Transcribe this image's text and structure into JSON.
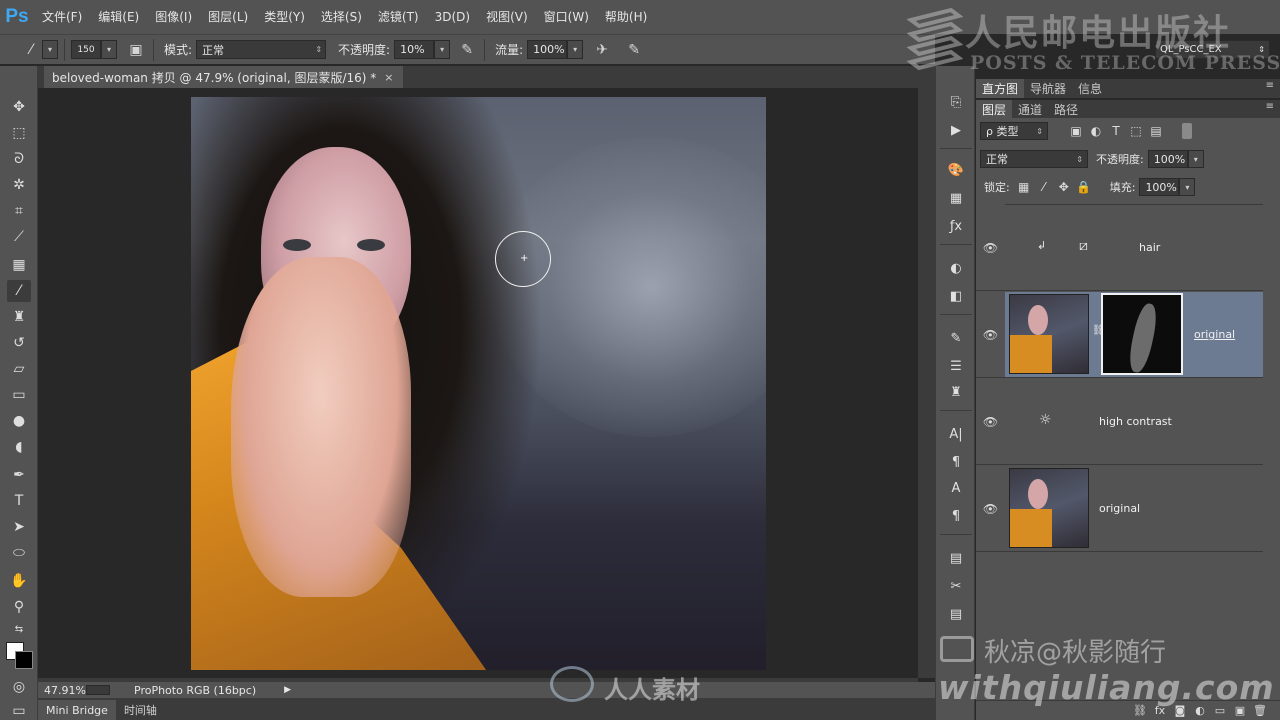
{
  "app": {
    "logo": "Ps"
  },
  "menu": [
    "文件(F)",
    "编辑(E)",
    "图像(I)",
    "图层(L)",
    "类型(Y)",
    "选择(S)",
    "滤镜(T)",
    "3D(D)",
    "视图(V)",
    "窗口(W)",
    "帮助(H)"
  ],
  "options": {
    "brush_size": "150",
    "mode_label": "模式:",
    "mode_value": "正常",
    "opacity_label": "不透明度:",
    "opacity_value": "10%",
    "flow_label": "流量:",
    "flow_value": "100%"
  },
  "workspace": {
    "preset": "QL_PsCC_EX"
  },
  "document": {
    "tab_title": "beloved-woman 拷贝 @ 47.9% (original, 图层蒙版/16) *",
    "close_glyph": "×"
  },
  "status": {
    "zoom": "47.91%",
    "profile": "ProPhoto RGB (16bpc)"
  },
  "bottom_tabs": [
    "Mini Bridge",
    "时间轴"
  ],
  "panels": {
    "top_tabs": [
      "直方图",
      "导航器",
      "信息"
    ],
    "layer_tabs": [
      "图层",
      "通道",
      "路径"
    ],
    "filter_kind": "ρ 类型",
    "blend_mode": "正常",
    "opacity_label": "不透明度:",
    "opacity_value": "100%",
    "lock_label": "锁定:",
    "fill_label": "填充:",
    "fill_value": "100%"
  },
  "layers": [
    {
      "name": "hair",
      "kind": "adjustment-clipped"
    },
    {
      "name": "original",
      "kind": "pixel-with-mask",
      "selected": true
    },
    {
      "name": "high contrast",
      "kind": "adjustment"
    },
    {
      "name": "original",
      "kind": "pixel"
    }
  ],
  "watermarks": {
    "publisher_cn": "人民邮电出版社",
    "publisher_en": "POSTS & TELECOM PRESS",
    "author": "秋凉@秋影随行",
    "site": "withqiuliang.com",
    "rr": "人人素材"
  },
  "colors": {
    "accent_ps": "#3fa9f5",
    "selected_layer": "#6c7b92",
    "panel": "#535353"
  }
}
